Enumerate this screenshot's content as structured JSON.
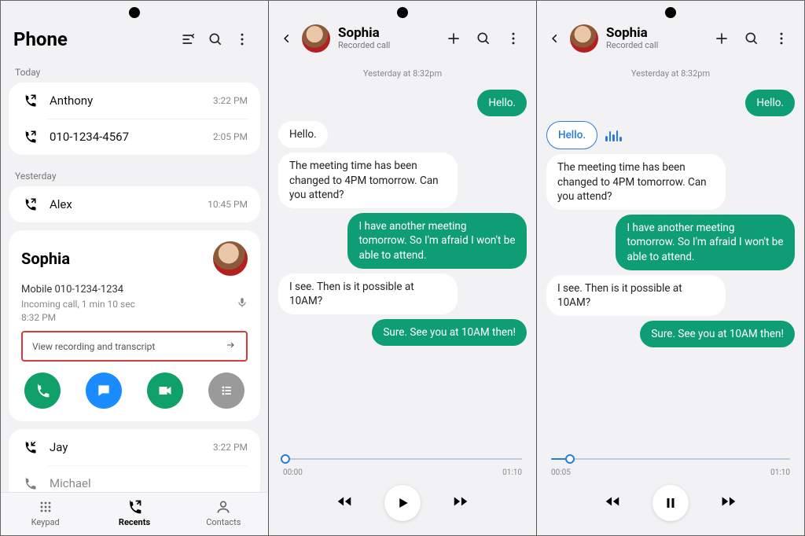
{
  "screen1": {
    "title": "Phone",
    "sections": [
      {
        "label": "Today",
        "items": [
          {
            "name": "Anthony",
            "time": "3:22 PM"
          },
          {
            "name": "010-1234-4567",
            "time": "2:05 PM"
          }
        ]
      },
      {
        "label": "Yesterday",
        "items": [
          {
            "name": "Alex",
            "time": "10:45 PM"
          }
        ]
      }
    ],
    "expanded": {
      "name": "Sophia",
      "number_label": "Mobile 010-1234-1234",
      "call_info": "Incoming call, 1 min 10 sec",
      "time": "8:32 PM",
      "view_recording": "View recording and transcript"
    },
    "more_items": [
      {
        "name": "Jay",
        "time": "3:22 PM"
      },
      {
        "name": "Michael",
        "time": ""
      }
    ],
    "nav": {
      "keypad": "Keypad",
      "recents": "Recents",
      "contacts": "Contacts"
    }
  },
  "transcript": {
    "contact": "Sophia",
    "subtitle": "Recorded call",
    "timestamp": "Yesterday at 8:32pm",
    "messages": [
      {
        "side": "me",
        "text": "Hello."
      },
      {
        "side": "other",
        "text": "Hello."
      },
      {
        "side": "other",
        "text": "The meeting time has been changed to 4PM tomorrow. Can you attend?"
      },
      {
        "side": "me",
        "text": "I have another meeting tomorrow. So I'm afraid I won't be able to attend."
      },
      {
        "side": "other",
        "text": "I see. Then is it possible at 10AM?"
      },
      {
        "side": "me",
        "text": "Sure. See you at 10AM then!"
      }
    ],
    "duration": "01:10"
  },
  "player_a": {
    "pos": "00:00",
    "dur": "01:10",
    "progress": 0,
    "state": "play"
  },
  "player_b": {
    "pos": "00:05",
    "dur": "01:10",
    "progress": 8,
    "state": "pause"
  }
}
